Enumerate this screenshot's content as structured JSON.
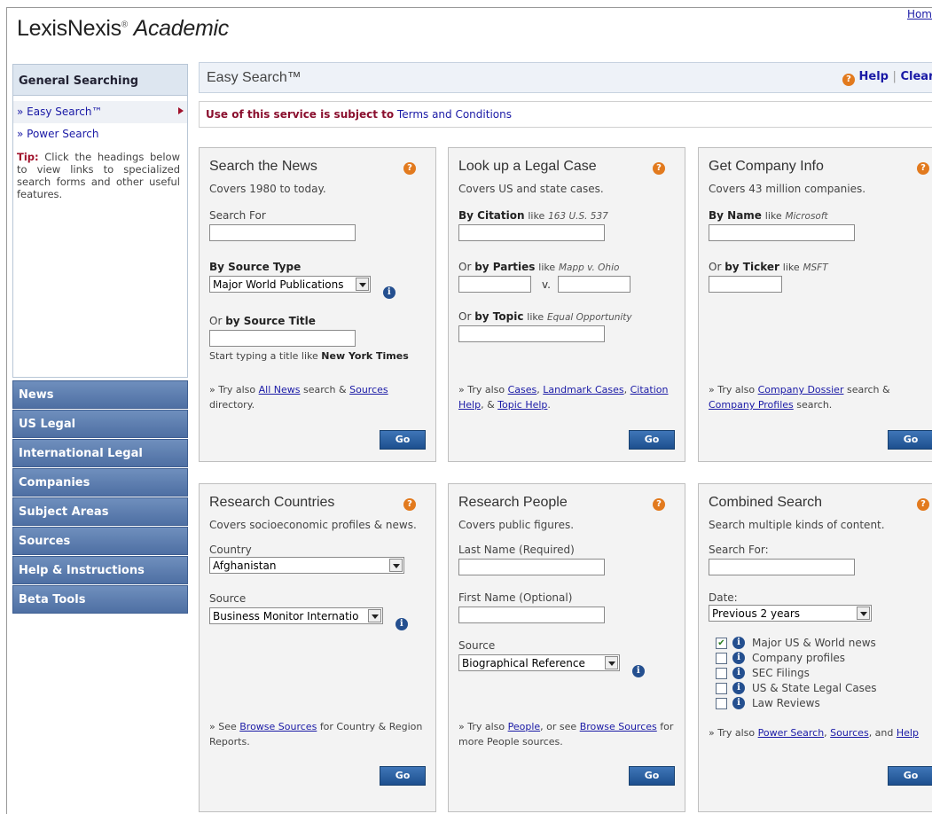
{
  "header": {
    "logo_main": "LexisNexis",
    "logo_reg": "®",
    "logo_italic": "Academic",
    "home_link": "Hom"
  },
  "sidebar": {
    "section_title": "General Searching",
    "links": [
      "» Easy Search™",
      "» Power Search"
    ],
    "tip_label": "Tip:",
    "tip_text": "Click the headings below to view links to specialized search forms and other useful features.",
    "nav": [
      "News",
      "US Legal",
      "International Legal",
      "Companies",
      "Subject Areas",
      "Sources",
      "Help & Instructions",
      "Beta Tools"
    ]
  },
  "titlebar": {
    "title": "Easy Search™",
    "help": "Help",
    "separator": "|",
    "clear": "Clear"
  },
  "terms": {
    "prefix": "Use of this service is subject to",
    "link": "Terms and Conditions"
  },
  "go_label": "Go",
  "panels": {
    "news": {
      "title": "Search the News",
      "subtitle": "Covers 1980 to today.",
      "search_label": "Search For",
      "source_type_label": "By Source Type",
      "source_type_value": "Major World Publications",
      "or": "Or",
      "source_title_label": "by Source Title",
      "hint_prefix": "Start typing a title like",
      "hint_example": "New York Times",
      "try_prefix": "» Try also",
      "link1": "All News",
      "mid1": "search &",
      "link2": "Sources",
      "suffix": "directory."
    },
    "legal": {
      "title": "Look up a Legal Case",
      "subtitle": "Covers US and state cases.",
      "citation_label": "By Citation",
      "like": "like",
      "citation_example": "163 U.S. 537",
      "or": "Or",
      "parties_label": "by Parties",
      "parties_example": "Mapp v. Ohio",
      "vs": "v.",
      "topic_label": "by Topic",
      "topic_example": "Equal Opportunity",
      "try_prefix": "» Try also",
      "link1": "Cases",
      "link2": "Landmark Cases",
      "link3": "Citation Help",
      "amp": "&",
      "link4": "Topic Help",
      "period": "."
    },
    "company": {
      "title": "Get Company Info",
      "subtitle": "Covers 43 million companies.",
      "name_label": "By Name",
      "like": "like",
      "name_example": "Microsoft",
      "or": "Or",
      "ticker_label": "by Ticker",
      "ticker_example": "MSFT",
      "try_prefix": "» Try also",
      "link1": "Company Dossier",
      "mid1": "search &",
      "link2": "Company Profiles",
      "suffix": "search."
    },
    "countries": {
      "title": "Research Countries",
      "subtitle": "Covers socioeconomic profiles & news.",
      "country_label": "Country",
      "country_value": "Afghanistan",
      "source_label": "Source",
      "source_value": "Business Monitor Internatio",
      "see_prefix": "» See",
      "link1": "Browse Sources",
      "suffix": "for Country & Region Reports."
    },
    "people": {
      "title": "Research People",
      "subtitle": "Covers public figures.",
      "last_label": "Last Name (Required)",
      "first_label": "First Name (Optional)",
      "source_label": "Source",
      "source_value": "Biographical Reference",
      "try_prefix": "» Try also",
      "link1": "People",
      "mid1": ", or see",
      "link2": "Browse Sources",
      "suffix": "for more People sources."
    },
    "combined": {
      "title": "Combined Search",
      "subtitle": "Search multiple kinds of content.",
      "search_label": "Search For:",
      "date_label": "Date:",
      "date_value": "Previous 2 years",
      "options": [
        "Major US & World news",
        "Company profiles",
        "SEC Filings",
        "US & State Legal Cases",
        "Law Reviews"
      ],
      "checked_mark": "✔",
      "try_prefix": "» Try also",
      "link1": "Power Search",
      "link2": "Sources",
      "and": ", and",
      "link3": "Help"
    }
  },
  "icons": {
    "help": "?",
    "info": "i",
    "help_color": "#e27a1e",
    "info_color": "#244f8f",
    "nav_color": "#5a7bb0"
  }
}
